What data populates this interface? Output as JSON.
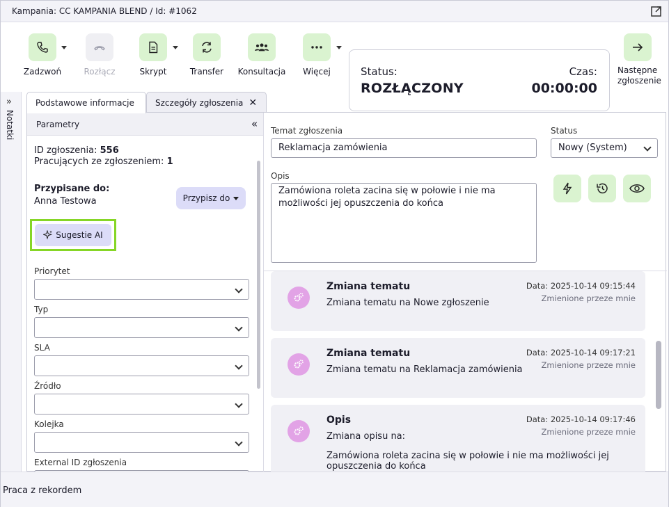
{
  "title": "Kampania: CC KAMPANIA BLEND / Id: #1062",
  "toolbar": {
    "call": "Zadzwoń",
    "hangup": "Rozłącz",
    "script": "Skrypt",
    "transfer": "Transfer",
    "consult": "Konsultacja",
    "more": "Więcej",
    "next_line1": "Następne",
    "next_line2": "zgłoszenie"
  },
  "status": {
    "label": "Status:",
    "value": "ROZŁĄCZONY",
    "time_label": "Czas:",
    "time_value": "00:00:00"
  },
  "sidebar": {
    "notes": "Notatki"
  },
  "tabs": [
    {
      "label": "Podstawowe informacje"
    },
    {
      "label": "Szczegóły zgłoszenia"
    }
  ],
  "params": {
    "header": "Parametry",
    "id_label": "ID zgłoszenia:",
    "id_value": "556",
    "working_label": "Pracujących ze zgłoszeniem:",
    "working_value": "1",
    "assigned_label": "Przypisane do:",
    "assigned_value": "Anna Testowa",
    "assign_button": "Przypisz do",
    "ai_button": "Sugestie AI",
    "fields": [
      {
        "label": "Priorytet",
        "value": ""
      },
      {
        "label": "Typ",
        "value": ""
      },
      {
        "label": "SLA",
        "value": ""
      },
      {
        "label": "Źródło",
        "value": ""
      },
      {
        "label": "Kolejka",
        "value": ""
      },
      {
        "label": "External ID zgłoszenia",
        "value": ""
      }
    ]
  },
  "ticket": {
    "subject_label": "Temat zgłoszenia",
    "subject_value": "Reklamacja zamówienia",
    "status_label": "Status",
    "status_value": "Nowy (System)",
    "desc_label": "Opis",
    "desc_value": "Zamówiona roleta zacina się w połowie i nie ma możliwości jej opuszczenia do końca"
  },
  "history": [
    {
      "title": "Zmiana tematu",
      "desc": "Zmiana tematu na Nowe zgłoszenie",
      "date": "Data: 2025-10-14 09:15:44",
      "by": "Zmienione przeze mnie"
    },
    {
      "title": "Zmiana tematu",
      "desc": "Zmiana tematu na Reklamacja zamówienia",
      "date": "Data: 2025-10-14 09:17:21",
      "by": "Zmienione przeze mnie"
    },
    {
      "title": "Opis",
      "desc": "Zmiana opisu na:",
      "full": "Zamówiona roleta zacina się w połowie i nie ma możliwości jej opuszczenia do końca",
      "date": "Data: 2025-10-14 09:17:46",
      "by": "Zmienione przeze mnie"
    }
  ],
  "footer": "Praca z rekordem",
  "colors": {
    "action_green": "#daf3d0",
    "ai_highlight": "#86d626",
    "button_lavender": "#dcdcf8",
    "avatar_pink": "#e2a3e6"
  }
}
